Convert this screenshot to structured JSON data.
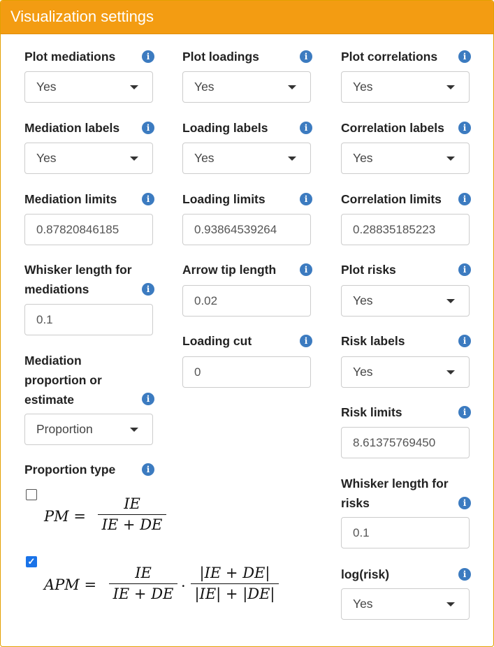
{
  "panel": {
    "title": "Visualization settings"
  },
  "icons": {
    "info": "info-icon",
    "dropdown": "caret-down-icon"
  },
  "col1": {
    "plot_mediations": {
      "label": "Plot mediations",
      "value": "Yes"
    },
    "mediation_labels": {
      "label": "Mediation labels",
      "value": "Yes"
    },
    "mediation_limits": {
      "label": "Mediation limits",
      "value": "0.87820846185"
    },
    "whisker_mediations": {
      "label_line1": "Whisker length for",
      "label_line2": "mediations",
      "value": "0.1"
    },
    "mediation_prop": {
      "label_line1": "Mediation",
      "label_line2": "proportion or",
      "label_line3": "estimate",
      "value": "Proportion"
    },
    "proportion_type": {
      "label": "Proportion type",
      "options": [
        {
          "checked": false,
          "lhs": "PM",
          "eq": "=",
          "num": "IE",
          "den": "IE + DE"
        },
        {
          "checked": true,
          "lhs": "APM",
          "eq": "=",
          "num": "IE",
          "den": "IE + DE",
          "dot": "·",
          "num2": "|IE + DE|",
          "den2": "|IE| + |DE|"
        }
      ]
    }
  },
  "col2": {
    "plot_loadings": {
      "label": "Plot loadings",
      "value": "Yes"
    },
    "loading_labels": {
      "label": "Loading labels",
      "value": "Yes"
    },
    "loading_limits": {
      "label": "Loading limits",
      "value": "0.93864539264"
    },
    "arrow_tip": {
      "label": "Arrow tip length",
      "value": "0.02"
    },
    "loading_cut": {
      "label": "Loading cut",
      "value": "0"
    }
  },
  "col3": {
    "plot_correlations": {
      "label": "Plot correlations",
      "value": "Yes"
    },
    "correlation_labels": {
      "label": "Correlation labels",
      "value": "Yes"
    },
    "correlation_limits": {
      "label": "Correlation limits",
      "value": "0.28835185223"
    },
    "plot_risks": {
      "label": "Plot risks",
      "value": "Yes"
    },
    "risk_labels": {
      "label": "Risk labels",
      "value": "Yes"
    },
    "risk_limits": {
      "label": "Risk limits",
      "value": "8.61375769450"
    },
    "whisker_risks": {
      "label_line1": "Whisker length for",
      "label_line2": "risks",
      "value": "0.1"
    },
    "log_risk": {
      "label": "log(risk)",
      "value": "Yes"
    }
  }
}
